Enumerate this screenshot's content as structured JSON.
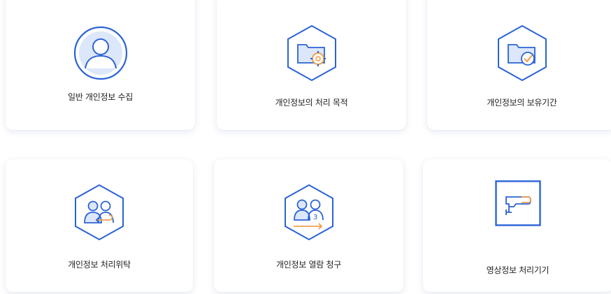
{
  "colors": {
    "primary_blue": "#2b63d6",
    "light_blue": "#dce7fb",
    "accent_orange": "#f0a04b"
  },
  "cards": [
    {
      "label": "일반 개인정보 수집",
      "icon": "user-profile-icon"
    },
    {
      "label": "개인정보의 처리 목적",
      "icon": "folder-gear-icon"
    },
    {
      "label": "개인정보의 보유기간",
      "icon": "folder-clock-check-icon"
    },
    {
      "label": "개인정보 처리위탁",
      "icon": "users-delegate-icon"
    },
    {
      "label": "개인정보 열람 청구",
      "icon": "users-request-icon"
    },
    {
      "label": "영상정보 처리기기",
      "icon": "cctv-camera-icon"
    }
  ]
}
